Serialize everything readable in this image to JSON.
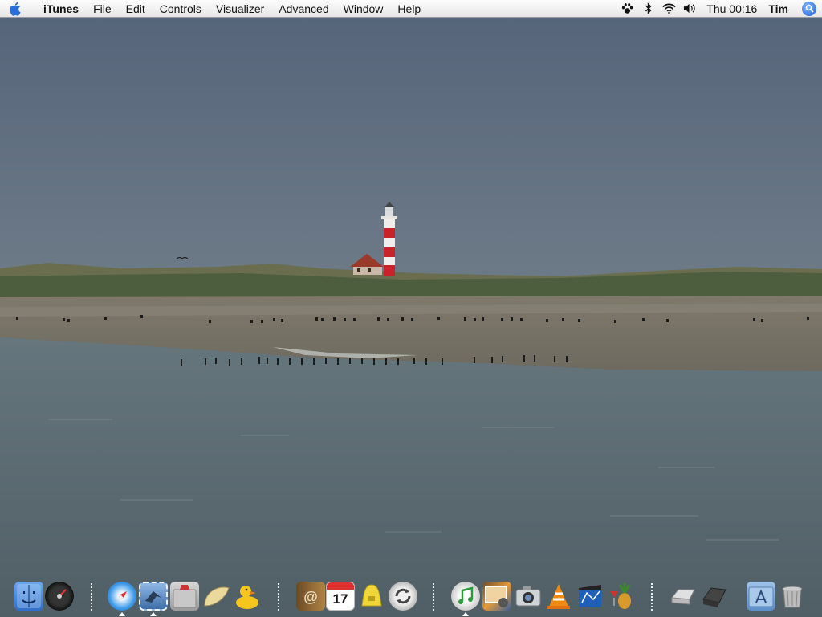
{
  "menubar": {
    "app_name": "iTunes",
    "menus": [
      "File",
      "Edit",
      "Controls",
      "Visualizer",
      "Advanced",
      "Window",
      "Help"
    ],
    "status_icons": [
      "paw-icon",
      "bluetooth-icon",
      "wifi-icon",
      "volume-icon"
    ],
    "clock": "Thu 00:16",
    "user": "Tim"
  },
  "colors": {
    "sky": "#5f6d7d",
    "water": "#5a6a70",
    "sand": "#7b786c",
    "dune": "#4f6040",
    "lighthouse_red": "#c8232a",
    "roof": "#9a3a2a",
    "spotlight_blue": "#1d5fd6"
  },
  "dock": {
    "items": [
      {
        "name": "finder-icon",
        "running": false
      },
      {
        "name": "dashboard-icon",
        "running": false
      },
      {
        "name": "separator"
      },
      {
        "name": "safari-icon",
        "running": true
      },
      {
        "name": "mail-icon",
        "running": true
      },
      {
        "name": "ical-folder-icon",
        "running": false
      },
      {
        "name": "taco-icon",
        "running": false
      },
      {
        "name": "rubber-duck-icon",
        "running": false
      },
      {
        "name": "separator"
      },
      {
        "name": "address-book-icon",
        "running": false
      },
      {
        "name": "ical-icon",
        "running": false
      },
      {
        "name": "raincoat-icon",
        "running": false
      },
      {
        "name": "sync-icon",
        "running": false
      },
      {
        "name": "separator"
      },
      {
        "name": "itunes-icon",
        "running": true
      },
      {
        "name": "iphoto-icon",
        "running": false
      },
      {
        "name": "image-capture-icon",
        "running": false
      },
      {
        "name": "vlc-icon",
        "running": false
      },
      {
        "name": "imovie-icon",
        "running": false
      },
      {
        "name": "pineapple-icon",
        "running": false
      },
      {
        "name": "separator"
      },
      {
        "name": "disk-icon",
        "running": false
      },
      {
        "name": "burn-icon",
        "running": false
      },
      {
        "name": "applications-folder-icon",
        "running": false
      },
      {
        "name": "trash-icon",
        "running": false
      }
    ],
    "ical_day": "17"
  }
}
